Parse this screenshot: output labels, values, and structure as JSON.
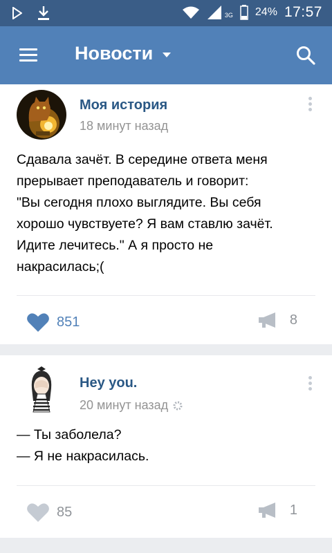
{
  "status_bar": {
    "network": "3G",
    "battery": "24%",
    "time": "17:57"
  },
  "header": {
    "title": "Новости"
  },
  "posts": [
    {
      "author": "Моя история",
      "time": "18 минут назад",
      "lines": [
        "Сдавала зачёт. В середине ответа меня",
        "прерывает преподаватель и говорит:",
        "\"Вы сегодня плохо выглядите. Вы себя",
        "хорошо чувствуете? Я вам ставлю зачёт.",
        "Идите лечитесь.\" А я просто не",
        "накрасилась;("
      ],
      "likes": "851",
      "shares": "8",
      "liked": true
    },
    {
      "author": "Hey you.",
      "time": "20 минут назад",
      "lines": [
        "— Ты заболела?",
        "— Я не накрасилась."
      ],
      "likes": "85",
      "shares": "1",
      "liked": false
    }
  ],
  "colors": {
    "header": "#5181b8",
    "status_bar": "#3a5d87",
    "link": "#2a5885",
    "liked": "#5181b8",
    "muted": "#909499"
  }
}
